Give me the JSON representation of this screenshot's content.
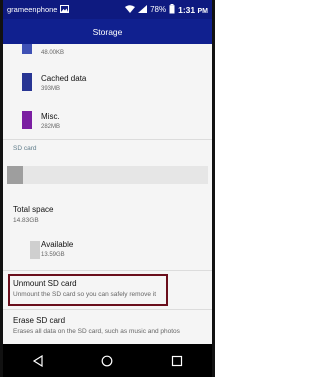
{
  "status_bar": {
    "carrier": "grameenphone",
    "battery_percent": "78%",
    "time": "1:31",
    "time_suffix": "PM"
  },
  "app_bar": {
    "title": "Storage"
  },
  "internal_items": [
    {
      "label": "",
      "size": "48.00KB",
      "color": "#3f51b5"
    },
    {
      "label": "Cached data",
      "size": "393MB",
      "color": "#283593"
    },
    {
      "label": "Misc.",
      "size": "282MB",
      "color": "#7b1fa2"
    }
  ],
  "sd_section": {
    "header": "SD card",
    "used_fraction": 0.08,
    "total_label": "Total space",
    "total_value": "14.83GB",
    "available_label": "Available",
    "available_value": "13.59GB",
    "available_color": "#cfcfcf"
  },
  "actions": {
    "unmount_title": "Unmount SD card",
    "unmount_sub": "Unmount the SD card so you can safely remove it",
    "erase_title": "Erase SD card",
    "erase_sub": "Erases all data on the SD card, such as music and photos"
  },
  "colors": {
    "status_bar": "#0e1a80",
    "app_bar": "#10208f",
    "highlight_border": "#6a0e1c",
    "section_header": "#607d8b"
  }
}
